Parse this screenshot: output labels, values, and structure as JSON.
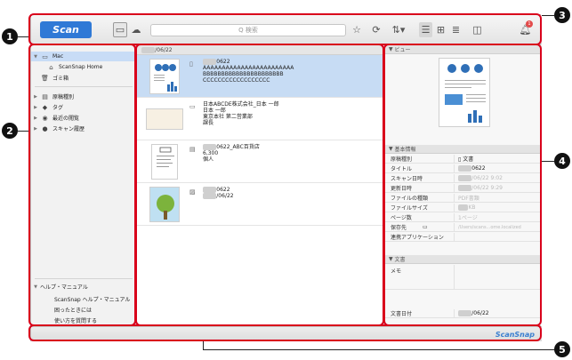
{
  "callouts": {
    "c1": "1",
    "c2": "2",
    "c3": "3",
    "c4": "4",
    "c5": "5"
  },
  "toolbar": {
    "scan_label": "Scan",
    "search_placeholder": "Q 検索",
    "star_icon": "star-icon",
    "badge_count": "1"
  },
  "sidebar": {
    "mac": "Mac",
    "home": "ScanSnap Home",
    "trash": "ゴミ箱",
    "items": [
      "原稿種別",
      "タグ",
      "最近の閲覧",
      "スキャン履歴"
    ],
    "help": {
      "title": "ヘルプ・マニュアル",
      "items": [
        "ScanSnap ヘルプ・マニュアル",
        "困ったときには",
        "使い方を質問する"
      ]
    }
  },
  "list": {
    "header_date": "/06/22",
    "docs": [
      {
        "title": "0622",
        "lines": [
          "AAAAAAAAAAAAAAAAAAAAAAAA",
          "BBBBBBBBBBBBBBBBBBBBBB",
          "CCCCCCCCCCCCCCCCCC"
        ]
      },
      {
        "title": "日本ABCDE株式会社_日本 一郎",
        "lines": [
          "日本 一郎",
          "東京本社 第二営業部",
          "課長"
        ]
      },
      {
        "title": "0622_ABC百貨店",
        "lines": [
          "6,300",
          "個人"
        ]
      },
      {
        "title": "0622",
        "lines": [
          "/06/22"
        ]
      }
    ]
  },
  "detail": {
    "preview_title": "ビュー",
    "basic_title": "基本情報",
    "props": [
      {
        "k": "原稿種別",
        "v": "文書"
      },
      {
        "k": "タイトル",
        "v": "0622"
      },
      {
        "k": "スキャン日時",
        "v": "/06/22 9:02"
      },
      {
        "k": "更新日時",
        "v": "/06/22 9:29"
      },
      {
        "k": "ファイルの種類",
        "v": "PDF書類"
      },
      {
        "k": "ファイルサイズ",
        "v": "KB"
      },
      {
        "k": "ページ数",
        "v": "1ページ"
      },
      {
        "k": "保存先",
        "v": "/Users/scans...ome.localized"
      },
      {
        "k": "連携アプリケーション",
        "v": ""
      }
    ],
    "doc_title": "文書",
    "memo": "メモ",
    "doc_date_label": "文書日付",
    "doc_date": "/06/22"
  },
  "statusbar": {
    "brand": "ScanSnap"
  }
}
